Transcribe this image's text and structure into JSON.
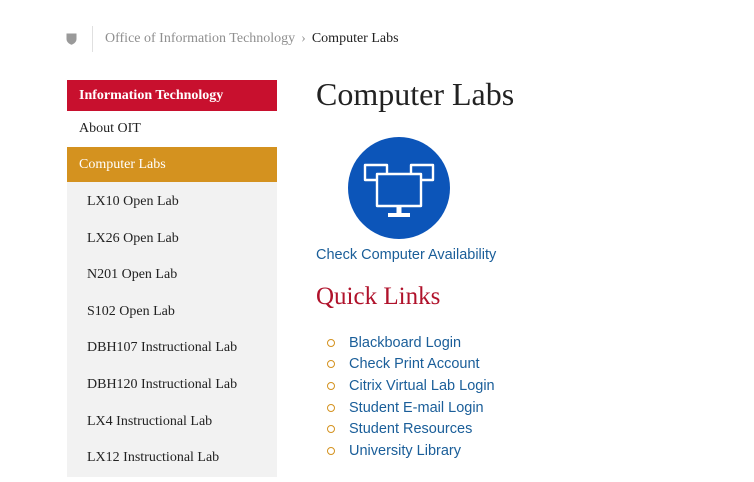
{
  "breadcrumb": {
    "parent": "Office of Information Technology",
    "separator": "›",
    "current": "Computer Labs"
  },
  "sidebar": {
    "heading": "Information Technology",
    "items": [
      {
        "label": "About OIT"
      },
      {
        "label": "Computer Labs",
        "active": true
      }
    ],
    "subitems": [
      {
        "label": "LX10 Open Lab"
      },
      {
        "label": "LX26 Open Lab"
      },
      {
        "label": "N201 Open Lab"
      },
      {
        "label": "S102 Open Lab"
      },
      {
        "label": "DBH107 Instructional Lab"
      },
      {
        "label": "DBH120 Instructional Lab"
      },
      {
        "label": "LX4 Instructional Lab"
      },
      {
        "label": "LX12 Instructional Lab"
      }
    ]
  },
  "main": {
    "title": "Computer Labs",
    "availability": {
      "icon": "computers-icon",
      "label": "Check Computer Availability"
    },
    "quick_links": {
      "title": "Quick Links",
      "items": [
        {
          "label": "Blackboard Login"
        },
        {
          "label": "Check Print Account"
        },
        {
          "label": "Citrix Virtual Lab Login"
        },
        {
          "label": "Student E-mail Login"
        },
        {
          "label": "Student Resources"
        },
        {
          "label": "University Library"
        }
      ]
    }
  },
  "colors": {
    "brand_red": "#c8102e",
    "active_gold": "#d4921f",
    "link_blue": "#1a5e99",
    "icon_blue": "#0c55b9"
  }
}
